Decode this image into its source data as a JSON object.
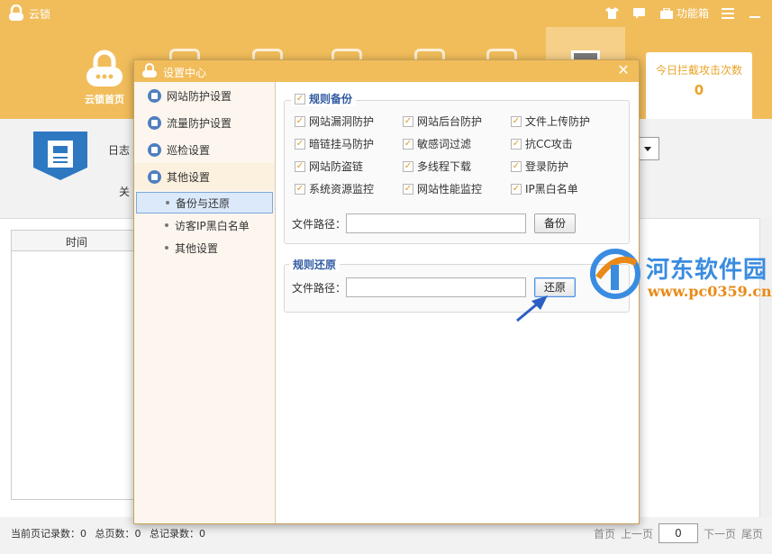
{
  "app": {
    "title": "云锁",
    "menu_label": "功能箱",
    "home_label": "云锁首页",
    "stat_label": "今日拦截攻击次数",
    "stat_value": "0"
  },
  "content": {
    "log_label": "日志",
    "close_label": "关",
    "col_time": "时间"
  },
  "status": {
    "page_records": "当前页记录数：0",
    "total_pages": "总页数：0",
    "total_records": "总记录数：0",
    "first": "首页",
    "prev": "上一页",
    "page_value": "0",
    "next": "下一页",
    "last": "尾页"
  },
  "dialog": {
    "title": "设置中心",
    "close_glyph": "✕",
    "sidebar": [
      {
        "label": "网站防护设置",
        "icon": "shield-icon"
      },
      {
        "label": "流量防护设置",
        "icon": "traffic-icon"
      },
      {
        "label": "巡检设置",
        "icon": "patrol-icon"
      },
      {
        "label": "其他设置",
        "icon": "settings-list-icon"
      }
    ],
    "subitems": [
      "备份与还原",
      "访客IP黑白名单",
      "其他设置"
    ],
    "backup": {
      "title": "规则备份",
      "items": [
        "网站漏洞防护",
        "网站后台防护",
        "文件上传防护",
        "暗链挂马防护",
        "敏感词过滤",
        "抗CC攻击",
        "网站防盗链",
        "多线程下载",
        "登录防护",
        "系统资源监控",
        "网站性能监控",
        "IP黑白名单"
      ],
      "path_label": "文件路径：",
      "button": "备份"
    },
    "restore": {
      "title": "规则还原",
      "path_label": "文件路径：",
      "button": "还原"
    }
  },
  "watermark": {
    "name": "河东软件园",
    "url": "www.pc0359.cn"
  },
  "colors": {
    "accent": "#f1bd5b",
    "link_blue": "#2f5aa1",
    "check_orange": "#e19a24"
  }
}
